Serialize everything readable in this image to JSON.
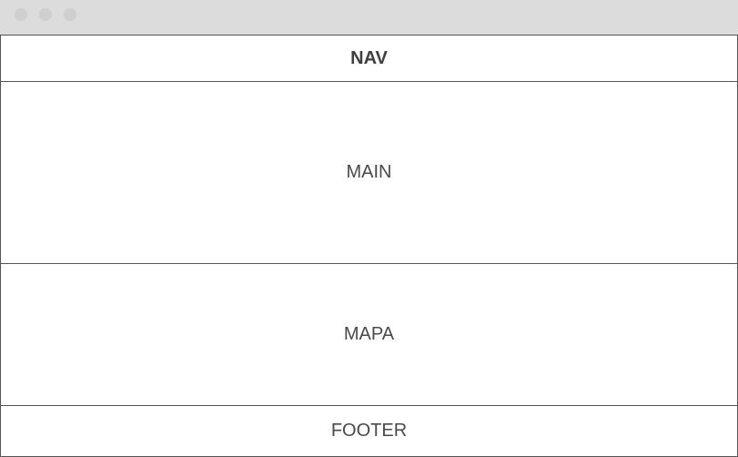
{
  "sections": {
    "nav": "NAV",
    "main": "MAIN",
    "mapa": "MAPA",
    "footer": "FOOTER"
  }
}
